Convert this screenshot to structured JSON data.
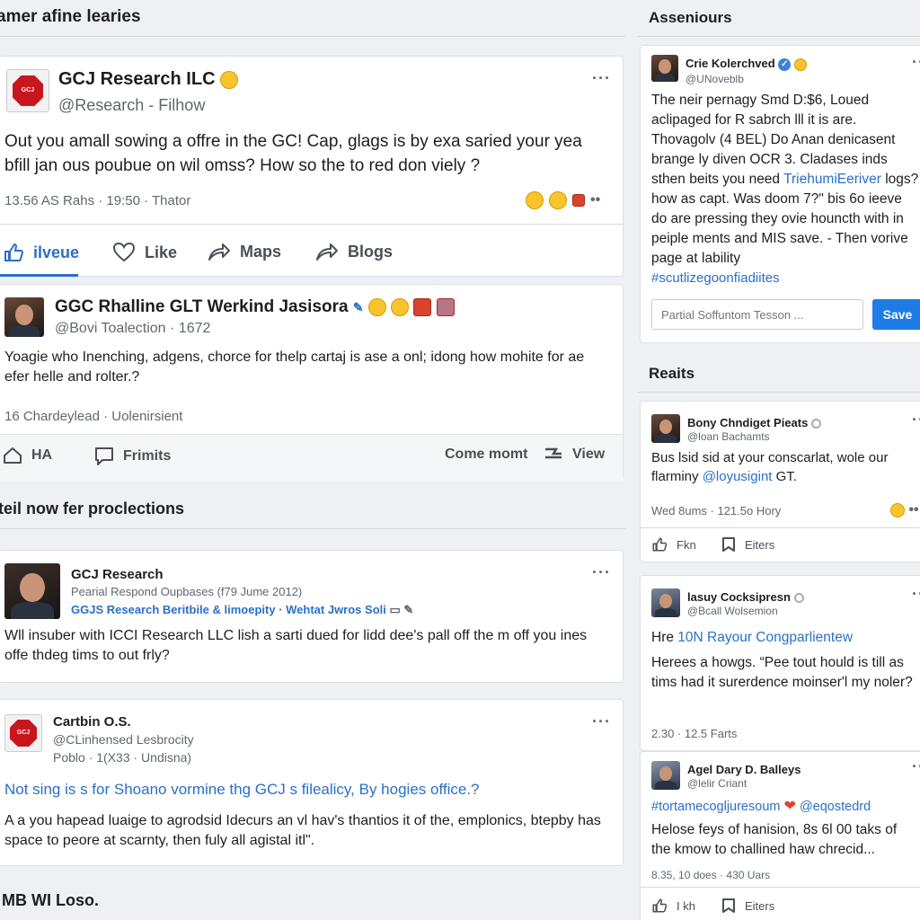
{
  "left": {
    "header_title": "amer afine learies",
    "post1": {
      "name": "GCJ Research ILC",
      "handle": "@Research - Filhow",
      "body": "Out you amall sowing a offre in the GC! Cap, glags is by exa saried your yea bfill jan ous poubue on wil omss? How so the to red don viely ?",
      "meta": "13.56 AS Rahs · 19:50 · Thator",
      "actions": [
        "ilveue",
        "Like",
        "Maps",
        "Blogs"
      ]
    },
    "post2": {
      "name": "GGC Rhalline GLT Werkind Jasisora",
      "handle": "@Bovi Toalection · 1672",
      "body": "Yoagie who Inenching, adgens, chorce for thelp cartaj is ase a onl; idong how mohite for ae efer helle and rolter.?",
      "meta": "16 Chardeylead · Uolenirsient",
      "actions": [
        "HA",
        "Frimits",
        "Come momt",
        "View"
      ]
    },
    "section2_title": "teil now fer proclections",
    "post3": {
      "name": "GCJ Research",
      "sub1": "Pearial Respond Oupbases (f79 Jume 2012)",
      "sub2": "GGJS Research Beritbile & limoepity · Wehtat Jwros Soli",
      "body": "Wll insuber with ICCI Research LLC lish a sarti dued for lidd dee's pall off the m off you ines offe thdeg tims to out frly?"
    },
    "post4": {
      "name": "Cartbin O.S.",
      "handle": "@CLinhensed Lesbrocity",
      "sub": "Poblo · 1(X33 · Undisna)",
      "headline": "Not sing is s for Shoano vormine thg GCJ s filealicy, By hogies office.?",
      "body": "A a you hapead luaige to agrodsid Idecurs an vl hav's thantios it of the, emplonics, btepby has space to peore at scarnty, then fuly all agistal itl\"."
    },
    "footer_title": "MB WI Loso."
  },
  "right": {
    "section1_title": "Asseniours",
    "card1": {
      "name": "Crie Kolerchved",
      "handle": "@UNoveblb",
      "body_plain": "The neir pernagy Smd D:$6, Loued aclipaged for R sabrch lll it is are. Thovagolv (4 BEL) Do Anan denicasent brange ly diven OCR 3. Cladases inds sthen beits you need ",
      "body_link": "TriehumiEeriver",
      "body_plain2": " logs? how as capt. Was doom 7?ʺ bis 6o ieeve do are pressing they ovie houncth with in peiple ments and MIS save. - Then vorive page at lability",
      "hashtag": "#scutlizegoonfiadiites",
      "input_placeholder": "Partial Soffuntom Tesson ...",
      "save_label": "Save"
    },
    "section2_title": "Reaits",
    "card2": {
      "name": "Bony Chndiget Pieats",
      "handle": "@loan Bachamts",
      "body_plain": "Bus lsid sid at your conscarlat, wole our flarminy ",
      "body_link": "@loyusigint",
      "body_plain2": " GT.",
      "meta": "Wed 8ums · 121.5o Hory",
      "actions": [
        "Fkn",
        "Eiters"
      ]
    },
    "card3": {
      "name": "lasuy Cocksipresn",
      "handle": "@Bcall Wolsemion",
      "headline_plain": "Hre ",
      "headline_link": "10N Rayour Congparlientew",
      "body": "Herees a howgs. “Pee tout hould is till as tims had it surerdence moinser'l my noler?",
      "meta": "2.30 · 12.5 Farts"
    },
    "card4": {
      "name": "Agel Dary D. Balleys",
      "handle": "@lelir Criant",
      "tags": "#tortamecogljuresoum",
      "tag2": "@eqostedrd",
      "body": "Helose feys of hanision, 8s 6l 00 taks of the kmow to challined haw chrecid...",
      "meta": "8.35, 10 does · 430 Uars",
      "actions": [
        "I kh",
        "Eiters"
      ]
    }
  },
  "colors": {
    "accent": "#2a6fc9",
    "save": "#1f7be6",
    "logo_red": "#c8161e"
  }
}
